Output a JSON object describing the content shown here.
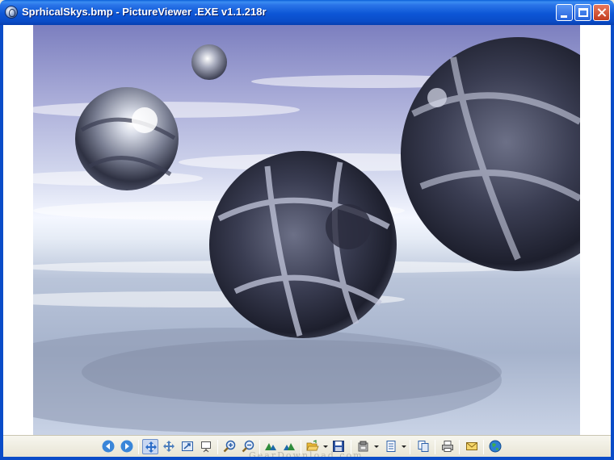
{
  "window": {
    "title": "SprhicalSkys.bmp - PictureViewer .EXE v1.1.218r",
    "controls": {
      "minimize": "minimize-button",
      "maximize": "maximize-button",
      "close": "close-button"
    }
  },
  "picture": {
    "file": "SprhicalSkys.bmp",
    "description_icon": "raytraced-chrome-spheres-image"
  },
  "toolbar": {
    "buttons": [
      {
        "name": "previous-image-button",
        "icon": "arrow-left-icon"
      },
      {
        "name": "next-image-button",
        "icon": "arrow-right-icon"
      },
      {
        "name": "fit-to-window-button",
        "icon": "fit-arrows-icon",
        "pressed": true
      },
      {
        "name": "actual-size-button",
        "icon": "expand-arrows-icon"
      },
      {
        "name": "full-screen-button",
        "icon": "full-screen-icon"
      },
      {
        "name": "slideshow-button",
        "icon": "slideshow-icon"
      },
      {
        "name": "zoom-in-button",
        "icon": "zoom-in-icon"
      },
      {
        "name": "zoom-out-button",
        "icon": "zoom-out-icon"
      },
      {
        "name": "rotate-left-button",
        "icon": "rotate-left-icon"
      },
      {
        "name": "rotate-right-button",
        "icon": "rotate-right-icon"
      },
      {
        "name": "open-button",
        "icon": "folder-open-icon"
      },
      {
        "name": "save-button",
        "icon": "floppy-disk-icon"
      },
      {
        "name": "tools-button",
        "icon": "tools-icon"
      },
      {
        "name": "properties-button",
        "icon": "document-list-icon"
      },
      {
        "name": "copy-button",
        "icon": "copy-icon"
      },
      {
        "name": "print-button",
        "icon": "printer-icon"
      },
      {
        "name": "email-button",
        "icon": "envelope-icon"
      },
      {
        "name": "web-button",
        "icon": "globe-icon"
      }
    ],
    "watermark": "GearDownload.com"
  },
  "colors": {
    "titlebar": "#0a4cc8",
    "toolbar_bg": "#ece9d8",
    "accent": "#2563dc"
  }
}
